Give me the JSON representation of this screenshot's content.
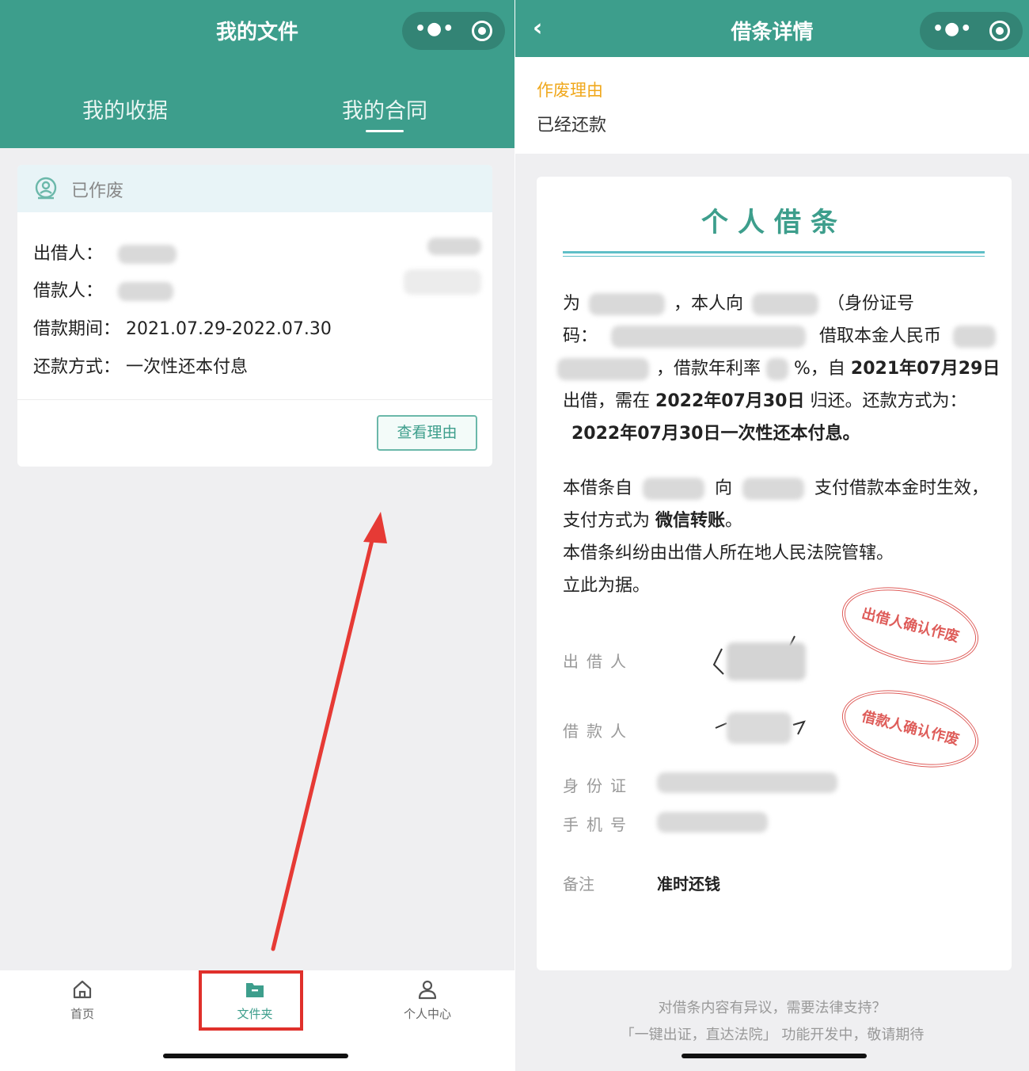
{
  "left": {
    "header": {
      "title": "我的文件"
    },
    "tabs": [
      {
        "label": "我的收据"
      },
      {
        "label": "我的合同"
      }
    ],
    "card": {
      "status": "已作废",
      "fields": [
        {
          "label": "出借人：",
          "value": ""
        },
        {
          "label": "借款人：",
          "value": ""
        },
        {
          "label": "借款期间：",
          "value": "2021.07.29-2022.07.30"
        },
        {
          "label": "还款方式：",
          "value": "一次性还本付息"
        }
      ],
      "button": "查看理由"
    },
    "tabbar": [
      {
        "label": "首页",
        "icon": "home-icon"
      },
      {
        "label": "文件夹",
        "icon": "folder-icon"
      },
      {
        "label": "个人中心",
        "icon": "person-icon"
      }
    ],
    "colors": {
      "brand": "#3d9e8c",
      "highlight": "#e0302b"
    }
  },
  "right": {
    "header": {
      "title": "借条详情"
    },
    "reason": {
      "label": "作废理由",
      "value": "已经还款"
    },
    "doc": {
      "title": "个人借条",
      "p1": {
        "t1": "为",
        "t2": "，本人向",
        "t3": "（身份证号",
        "t4": "码：",
        "t5": "借取本金人民币",
        "t6": "，借款年利率",
        "t7": "%，自",
        "t8": "2021年07月29日",
        "t9": "出借，需在",
        "t10": "2022年07月30日",
        "t11": "归还。还款方式为：",
        "t12": "2022年07月30日一次性还本付息。"
      },
      "p2": {
        "t1": "本借条自",
        "t2": "向",
        "t3": "支付借款本金时生效，",
        "t4": "支付方式为",
        "t5": "微信转账",
        "t6": "。",
        "t7": "本借条纠纷由出借人所在地人民法院管辖。",
        "t8": "立此为据。"
      },
      "signatures": {
        "lender": "出借人",
        "borrower": "借款人",
        "id": "身份证",
        "phone": "手机号"
      },
      "stamps": {
        "lender": "出借人确认作废",
        "borrower": "借款人确认作废"
      },
      "note": {
        "label": "备注",
        "value": "准时还钱"
      }
    },
    "footer": {
      "line1": "对借条内容有异议，需要法律支持？",
      "line2": "「一键出证，直达法院」 功能开发中，敬请期待"
    },
    "colors": {
      "reason_label": "#f0a81d",
      "stamp": "#d9403d"
    }
  }
}
